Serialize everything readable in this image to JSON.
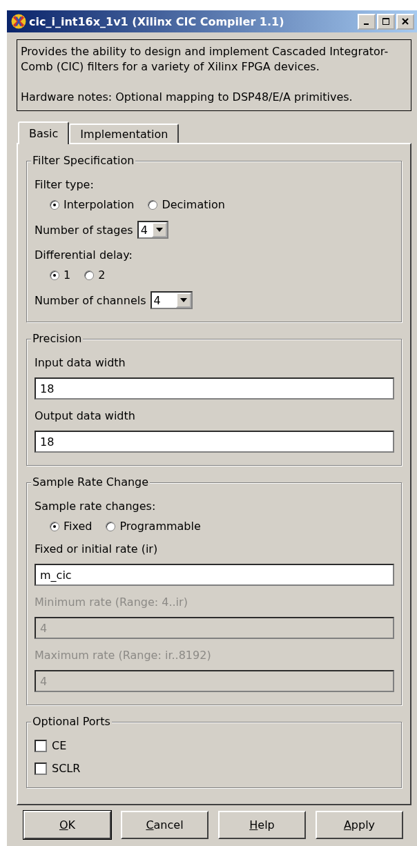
{
  "window": {
    "title": "cic_i_int16x_1v1  (Xilinx CIC Compiler 1.1)"
  },
  "description": [
    "Provides the ability to design and implement Cascaded Integrator-Comb (CIC) filters for a variety of Xilinx FPGA devices.",
    "Hardware notes: Optional mapping to DSP48/E/A primitives."
  ],
  "tabs": [
    {
      "label": "Basic",
      "selected": true
    },
    {
      "label": "Implementation",
      "selected": false
    }
  ],
  "groups": [
    {
      "title": "Filter Specification",
      "items": [
        {
          "kind": "radio_group",
          "label": "Filter type:",
          "options": [
            {
              "label": "Interpolation",
              "selected": true
            },
            {
              "label": "Decimation",
              "selected": false
            }
          ]
        },
        {
          "kind": "dropdown",
          "label": "Number of stages",
          "value": "4"
        },
        {
          "kind": "radio_group",
          "label": "Differential delay:",
          "options": [
            {
              "label": "1",
              "selected": true
            },
            {
              "label": "2",
              "selected": false
            }
          ]
        },
        {
          "kind": "dropdown",
          "label": "Number of channels",
          "value": "4"
        }
      ]
    },
    {
      "title": "Precision",
      "items": [
        {
          "kind": "text_field",
          "label": "Input data width",
          "value": "18",
          "disabled": false
        },
        {
          "kind": "text_field",
          "label": "Output data width",
          "value": "18",
          "disabled": false
        }
      ]
    },
    {
      "title": "Sample Rate Change",
      "items": [
        {
          "kind": "radio_group",
          "label": "Sample rate changes:",
          "options": [
            {
              "label": "Fixed",
              "selected": true
            },
            {
              "label": "Programmable",
              "selected": false
            }
          ]
        },
        {
          "kind": "text_field",
          "label": "Fixed or initial rate (ir)",
          "value": "m_cic",
          "disabled": false
        },
        {
          "kind": "text_field",
          "label": "Minimum rate (Range: 4..ir)",
          "value": "4",
          "disabled": true
        },
        {
          "kind": "text_field",
          "label": "Maximum rate (Range: ir..8192)",
          "value": "4",
          "disabled": true
        }
      ]
    },
    {
      "title": "Optional Ports",
      "items": [
        {
          "kind": "checkbox",
          "label": "CE",
          "checked": false
        },
        {
          "kind": "checkbox",
          "label": "SCLR",
          "checked": false
        }
      ]
    }
  ],
  "buttons": [
    {
      "label": "OK",
      "default": true
    },
    {
      "label": "Cancel",
      "default": false
    },
    {
      "label": "Help",
      "default": false
    },
    {
      "label": "Apply",
      "default": false
    }
  ]
}
